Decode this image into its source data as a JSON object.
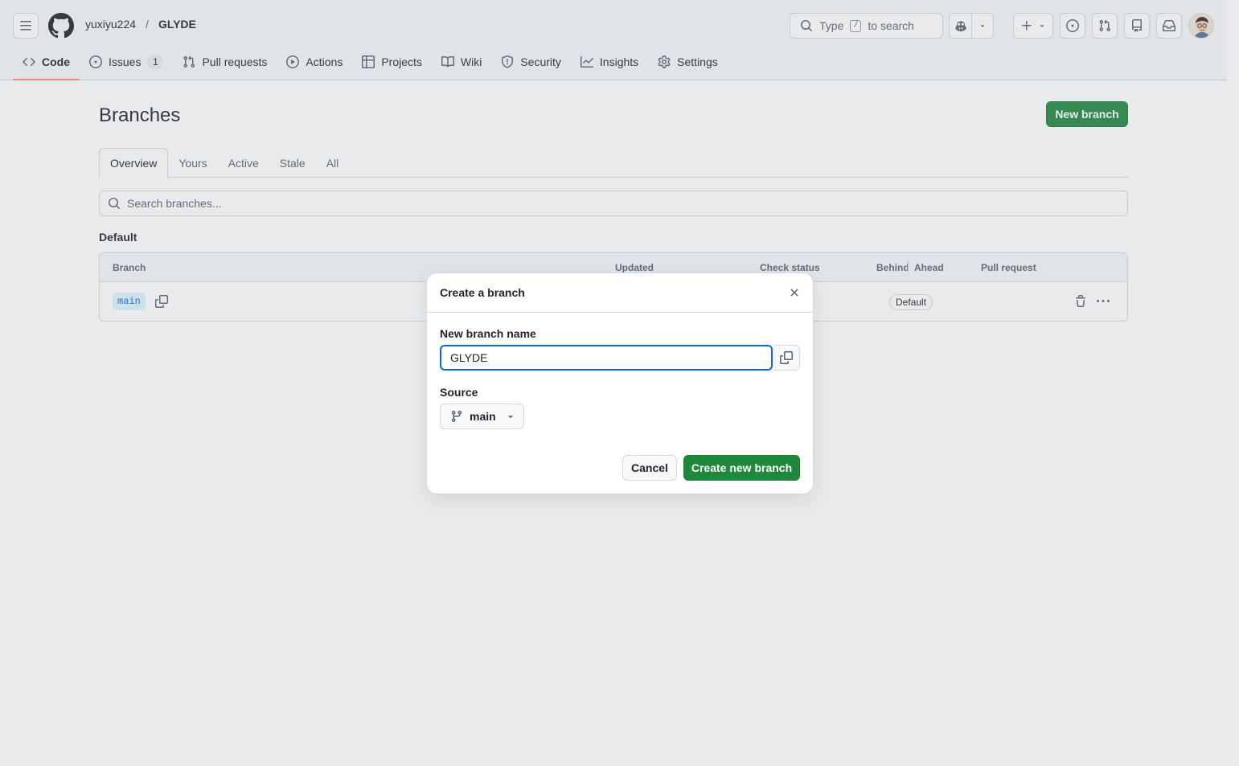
{
  "header": {
    "owner": "yuxiyu224",
    "separator": "/",
    "repo": "GLYDE",
    "search": {
      "prefix": "Type",
      "key": "/",
      "suffix": "to search"
    }
  },
  "nav_tabs": [
    {
      "label": "Code",
      "icon": "code-icon",
      "selected": true
    },
    {
      "label": "Issues",
      "icon": "issue-opened-icon",
      "count": "1"
    },
    {
      "label": "Pull requests",
      "icon": "git-pull-request-icon"
    },
    {
      "label": "Actions",
      "icon": "play-icon"
    },
    {
      "label": "Projects",
      "icon": "table-icon"
    },
    {
      "label": "Wiki",
      "icon": "book-icon"
    },
    {
      "label": "Security",
      "icon": "shield-icon"
    },
    {
      "label": "Insights",
      "icon": "graph-icon"
    },
    {
      "label": "Settings",
      "icon": "gear-icon"
    }
  ],
  "page": {
    "title": "Branches",
    "new_branch_label": "New branch",
    "subtabs": [
      "Overview",
      "Yours",
      "Active",
      "Stale",
      "All"
    ],
    "search_placeholder": "Search branches...",
    "section_title": "Default"
  },
  "table": {
    "columns": {
      "branch": "Branch",
      "updated": "Updated",
      "check": "Check status",
      "behind": "Behind",
      "ahead": "Ahead",
      "pr": "Pull request"
    },
    "row": {
      "branch": "main",
      "badge": "Default"
    }
  },
  "dialog": {
    "title": "Create a branch",
    "name_label": "New branch name",
    "name_value": "GLYDE",
    "source_label": "Source",
    "source_value": "main",
    "cancel_label": "Cancel",
    "create_label": "Create new branch"
  },
  "colors": {
    "primary": "#1f883d",
    "focus": "#0969da",
    "tab_underline": "#fd8c73"
  }
}
